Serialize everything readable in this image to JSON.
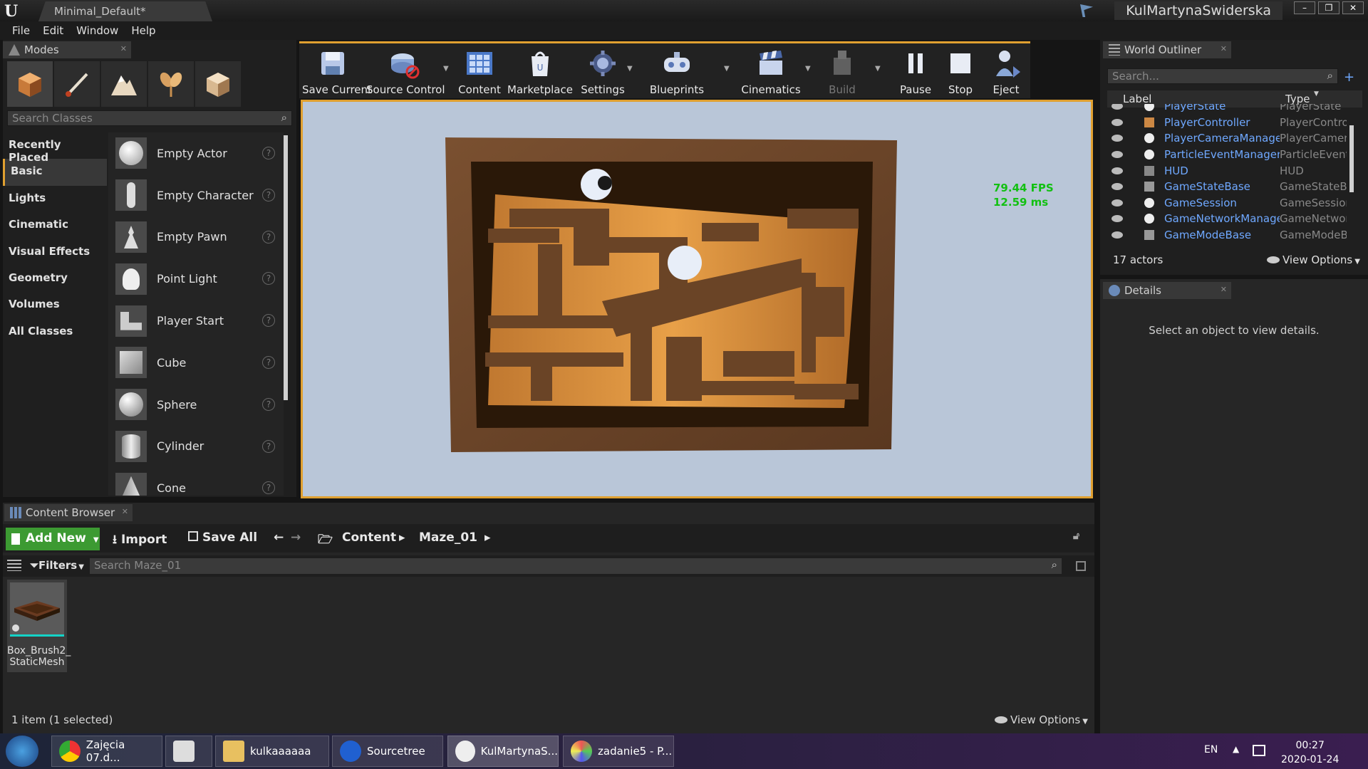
{
  "window": {
    "doc_tab": "Minimal_Default*",
    "user": "KulMartynaSwiderska",
    "controls": [
      "–",
      "❐",
      "✕"
    ]
  },
  "menu": [
    "File",
    "Edit",
    "Window",
    "Help"
  ],
  "modes": {
    "tab": "Modes",
    "search_placeholder": "Search Classes",
    "categories": [
      "Recently Placed",
      "Basic",
      "Lights",
      "Cinematic",
      "Visual Effects",
      "Geometry",
      "Volumes",
      "All Classes"
    ],
    "selected_category": "Basic",
    "classes": [
      "Empty Actor",
      "Empty Character",
      "Empty Pawn",
      "Point Light",
      "Player Start",
      "Cube",
      "Sphere",
      "Cylinder",
      "Cone"
    ]
  },
  "toolbar": {
    "buttons": [
      {
        "label": "Save Current",
        "icon": "save-icon"
      },
      {
        "label": "Source Control",
        "icon": "source-control-icon"
      },
      {
        "label": "Content",
        "icon": "content-icon"
      },
      {
        "label": "Marketplace",
        "icon": "marketplace-icon"
      },
      {
        "label": "Settings",
        "icon": "settings-icon"
      },
      {
        "label": "Blueprints",
        "icon": "blueprints-icon"
      },
      {
        "label": "Cinematics",
        "icon": "cinematics-icon"
      },
      {
        "label": "Build",
        "icon": "build-icon"
      },
      {
        "label": "Pause",
        "icon": "pause-icon"
      },
      {
        "label": "Stop",
        "icon": "stop-icon"
      },
      {
        "label": "Eject",
        "icon": "eject-icon"
      }
    ]
  },
  "viewport": {
    "fps": "79.44 FPS",
    "ms": "12.59 ms"
  },
  "outliner": {
    "tab": "World Outliner",
    "search_placeholder": "Search...",
    "col_label": "Label",
    "col_type": "Type",
    "rows": [
      {
        "label": "PlayerState",
        "type": "PlayerState"
      },
      {
        "label": "PlayerController",
        "type": "PlayerContro"
      },
      {
        "label": "PlayerCameraManager",
        "type": "PlayerCamera"
      },
      {
        "label": "ParticleEventManager",
        "type": "ParticleEvent"
      },
      {
        "label": "HUD",
        "type": "HUD"
      },
      {
        "label": "GameStateBase",
        "type": "GameStateBa"
      },
      {
        "label": "GameSession",
        "type": "GameSession"
      },
      {
        "label": "GameNetworkManager",
        "type": "GameNetworl"
      },
      {
        "label": "GameModeBase",
        "type": "GameModeBa"
      }
    ],
    "actor_count": "17 actors",
    "view_options": "View Options"
  },
  "details": {
    "tab": "Details",
    "message": "Select an object to view details."
  },
  "content_browser": {
    "tab": "Content Browser",
    "add_new": "Add New",
    "import": "Import",
    "save_all": "Save All",
    "path": [
      "Content",
      "Maze_01"
    ],
    "filters": "Filters",
    "search_placeholder": "Search Maze_01",
    "asset_label_1": "Box_Brush2_",
    "asset_label_2": "StaticMesh",
    "status": "1 item (1 selected)",
    "view_options": "View Options"
  },
  "taskbar": {
    "items": [
      "Zajęcia 07.d...",
      "",
      "kulkaaaaaa",
      "Sourcetree",
      "KulMartynaS...",
      "zadanie5 - P..."
    ],
    "lang": "EN",
    "time": "00:27",
    "date": "2020-01-24"
  },
  "colors": {
    "accent": "#e0a030",
    "fps_green": "#12c012",
    "add_new_green": "#3c9a32",
    "outliner_label": "#6fa8ff"
  }
}
